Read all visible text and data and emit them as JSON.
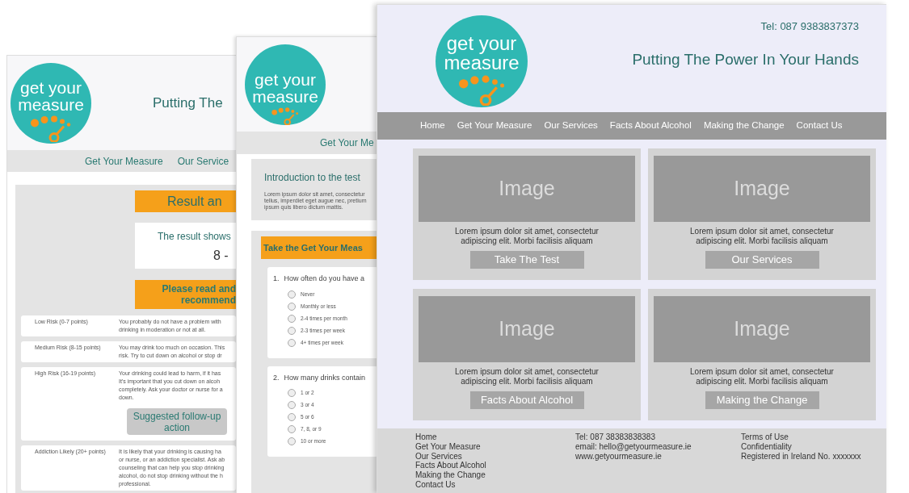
{
  "result_page": {
    "logo": [
      "get your",
      "measure"
    ],
    "tagline": "Putting The",
    "nav": [
      "Get Your Measure",
      "Our Service"
    ],
    "heading": "Result an",
    "result": [
      "The result shows",
      "8 -"
    ],
    "notice": [
      "Please read and",
      "recommend"
    ],
    "risks": [
      {
        "label": "Low Risk (0-7 points)",
        "text": "You probably do not have a problem with\ndrinking in moderation or not at all."
      },
      {
        "label": "Medium Risk (8-15 points)",
        "text": "You may drink too much on occasion. This\nrisk. Try to cut down on alcohol or stop dr"
      },
      {
        "label": "High Risk (16-19 points)",
        "text": "Your drinking could lead to harm, if it has\nIt's important that you cut down on alcoh\ncompletely. Ask your doctor or nurse for a\ndown.",
        "button": "Suggested follow-up action"
      },
      {
        "label": "Addiction Likely (20+ points)",
        "text": "It is likely that your drinking is causing ha\nor nurse, or an addiction specialist. Ask ab\ncounseling that can help you stop drinking\nalcohol, do not stop drinking without the h\nprofessional."
      }
    ]
  },
  "test_page": {
    "logo": [
      "get your",
      "measure"
    ],
    "nav": [
      "Get Your Me"
    ],
    "intro": {
      "title": "Introduction to the test",
      "text": "Lorem ipsum dolor sit amet, consectetur\ntellus, imperdiet eget augue nec, pretium\nipsum quis libero dictum mattis."
    },
    "test_title": "Take the Get Your Meas",
    "questions": [
      {
        "number": "1.",
        "text": "How often do you have a",
        "options": [
          {
            "label": "Never",
            "selected": false
          },
          {
            "label": "Monthly or less",
            "selected": false
          },
          {
            "label": "2-4 times per month",
            "selected": false
          },
          {
            "label": "2-3 times per week",
            "selected": false
          },
          {
            "label": "4+ times per week",
            "selected": false
          }
        ]
      },
      {
        "number": "2.",
        "text": "How many drinks contain",
        "options": [
          {
            "label": "1 or 2",
            "selected": false
          },
          {
            "label": "3 or 4",
            "selected": false
          },
          {
            "label": "5 or 6",
            "selected": false
          },
          {
            "label": "7, 8, or 9",
            "selected": false
          },
          {
            "label": "10 or more",
            "selected": false
          }
        ]
      }
    ]
  },
  "home_page": {
    "logo": [
      "get your",
      "measure"
    ],
    "phone": "Tel: 087 9383837373",
    "tagline": "Putting The Power In Your Hands",
    "nav": [
      "Home",
      "Get Your Measure",
      "Our Services",
      "Facts About Alcohol",
      "Making the Change",
      "Contact Us"
    ],
    "cards": [
      {
        "image": "Image",
        "text": "Lorem ipsum dolor sit amet, consectetur\nadipiscing elit. Morbi facilisis aliquam",
        "button": "Take The Test"
      },
      {
        "image": "Image",
        "text": "Lorem ipsum dolor sit amet, consectetur\nadipiscing elit. Morbi facilisis aliquam",
        "button": "Our Services"
      },
      {
        "image": "Image",
        "text": "Lorem ipsum dolor sit amet, consectetur\nadipiscing elit. Morbi facilisis aliquam",
        "button": "Facts About Alcohol"
      },
      {
        "image": "Image",
        "text": "Lorem ipsum dolor sit amet, consectetur\nadipiscing elit. Morbi facilisis aliquam",
        "button": "Making the Change"
      }
    ],
    "footer": [
      [
        "Home",
        "Get Your Measure",
        "Our Services",
        "Facts About Alcohol",
        "Making the Change",
        "Contact Us"
      ],
      [
        "Tel: 087 38383838383",
        "email: hello@getyourmeasure.ie",
        "www.getyourmeasure.ie"
      ],
      [
        "Terms of Use",
        "Confidentiality",
        "Registered in Ireland No. xxxxxxx"
      ]
    ]
  }
}
